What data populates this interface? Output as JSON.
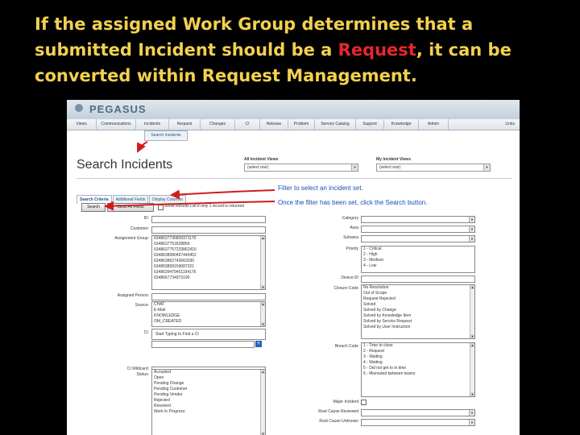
{
  "slide": {
    "title_pre": "If the assigned Work Group determines that a submitted Incident should be a ",
    "title_highlight": "Request",
    "title_post": ", it can be converted within Request Management."
  },
  "app": {
    "logo": "PEGASUS",
    "nav": [
      "Views",
      "Communications",
      "Incidents",
      "Request",
      "Changes",
      "CI",
      "Release",
      "Problem",
      "Service Catalog",
      "Support",
      "Knowledge",
      "Admin",
      "Links"
    ],
    "subtab": "Search Incidents",
    "page_title": "Search Incidents",
    "all_views_label": "All Incident Views",
    "all_views_value": "(select one)",
    "my_views_label": "My Incident Views",
    "my_views_value": "(select one)",
    "tabs": [
      "Search Criteria",
      "Additional Fields",
      "Display Columns"
    ],
    "search_button": "Search",
    "clear_button": "Clear All Fields",
    "show_results_label": "Show Results List if only 1 record is returned"
  },
  "annotations": {
    "line1": "Filter to select an incident set.",
    "line2": "Once the filter has been set, click the Search button."
  },
  "left_fields": {
    "id": "ID:",
    "customer": "Customer:",
    "assignment_group": "Assignment Group:",
    "assignment_group_options": [
      "6348637736809371170",
      "6348637751828856",
      "6348637757233862416",
      "6348638080497449452",
      "634863862743663030",
      "634863858159087021",
      "6348639470451194176",
      "6348667734973190"
    ],
    "assigned_person": "Assigned Person:",
    "source": "Source:",
    "source_options": [
      "CHAT",
      "E-Mail",
      "KNOWLEDGE",
      "OM_CREATED"
    ],
    "ci": "CI:",
    "ci_placeholder": "Start Typing to Find a CI",
    "ci_wildcard": "CI Wildcard:",
    "status": "Status:",
    "status_options": [
      "Accepted",
      "Open",
      "Pending Change",
      "Pending Customer",
      "Pending Vendor",
      "Rejected",
      "Resolved",
      "Work In Progress"
    ]
  },
  "right_fields": {
    "category": "Category",
    "area": "Area",
    "subarea": "Subarea",
    "priority": "Priority",
    "priority_options": [
      "1 - Critical",
      "2 - High",
      "3 - Medium",
      "4 - Low"
    ],
    "device_id": "Device ID",
    "closure_code": "Closure Code",
    "closure_options": [
      "No Resolution",
      "Out of Scope",
      "Request Rejected",
      "Solved",
      "Solved by Change",
      "Solved by Knowledge Item",
      "Solved by Service Request",
      "Solved by User Instruction"
    ],
    "breach_code": "Breach Code",
    "breach_options": [
      "1 - Time to close",
      "2 - Request",
      "3 - Waiting",
      "4 - Waiting",
      "5 - Did not get to in time",
      "6 - Misrouted between teams"
    ],
    "major_incident": "Major Incident",
    "root_cause_reviewed": "Root Cause Reviewed",
    "root_cause_unknown": "Root Cause Unknown"
  }
}
